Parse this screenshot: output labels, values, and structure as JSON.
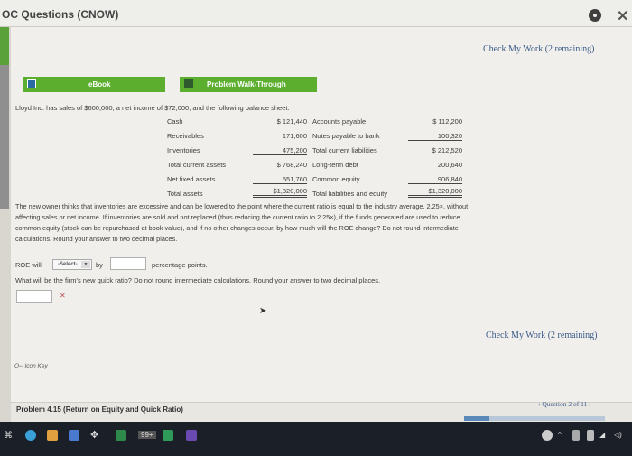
{
  "window": {
    "title": "OC Questions (CNOW)"
  },
  "check_my_work": "Check My Work (2 remaining)",
  "tabs": {
    "ebook": "eBook",
    "walkthrough": "Problem Walk-Through"
  },
  "intro": "Lloyd Inc. has sales of $600,000, a net income of $72,000, and the following balance sheet:",
  "balance_sheet": {
    "left_labels": [
      "Cash",
      "Receivables",
      "Inventories",
      "Total current assets",
      "Net fixed assets",
      "Total assets"
    ],
    "left_values": [
      "$  121,440",
      "171,600",
      "475,200",
      "$  768,240",
      "551,760",
      "$1,320,000"
    ],
    "right_labels": [
      "Accounts payable",
      "Notes payable to bank",
      "Total current liabilities",
      "Long-term debt",
      "Common equity",
      "Total liabilities and equity"
    ],
    "right_values": [
      "$  112,200",
      "100,320",
      "$  212,520",
      "200,640",
      "906,840",
      "$1,320,000"
    ]
  },
  "paragraph": [
    "The new owner thinks that inventories are excessive and can be lowered to the point where the current ratio is equal to the industry average, 2.25×, without",
    "affecting sales or net income. If inventories are sold and not replaced (thus reducing the current ratio to 2.25×), if the funds generated are used to reduce",
    "common equity (stock can be repurchased at book value), and if no other changes occur, by how much will the ROE change? Do not round intermediate",
    "calculations. Round your answer to two decimal places."
  ],
  "roe_question": {
    "prefix": "ROE will",
    "select_placeholder": "-Select-",
    "by": "by",
    "suffix": "percentage points.",
    "value": ""
  },
  "quick_ratio_question": "What will be the firm's new quick ratio? Do not round intermediate calculations. Round your answer to two decimal places.",
  "quick_ratio_value": "",
  "icon_key": "Icon Key",
  "footer": {
    "problem_title": "Problem 4.15 (Return on Equity and Quick Ratio)",
    "question_nav": "‹ Question 2 of 11 ›",
    "progress": 0.18
  },
  "taskbar": {
    "badge": "99+"
  },
  "colors": {
    "accent_green": "#5cae2f",
    "link_blue": "#3a5a8a",
    "taskbar": "#1b1f28"
  }
}
